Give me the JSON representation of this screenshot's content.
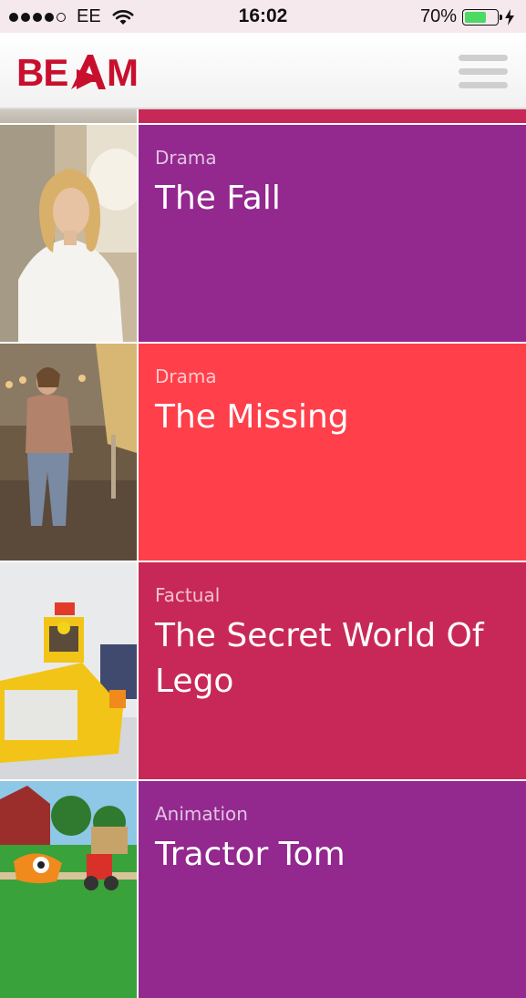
{
  "status_bar": {
    "carrier": "EE",
    "time": "16:02",
    "battery_percent_label": "70%",
    "battery_level": 0.7,
    "signal_dots_filled": 4,
    "signal_dots_total": 5
  },
  "header": {
    "logo_text": "BEAM",
    "menu_icon": "hamburger-menu-icon"
  },
  "colors": {
    "purple": "#93288f",
    "red": "#ff3f4a",
    "crimson": "#c82858"
  },
  "programmes": [
    {
      "genre": "Drama",
      "title": "The Fall",
      "color": "#93288f"
    },
    {
      "genre": "Drama",
      "title": "The Missing",
      "color": "#ff3f4a"
    },
    {
      "genre": "Factual",
      "title": "The Secret World Of Lego",
      "color": "#c82858"
    },
    {
      "genre": "Animation",
      "title": "Tractor Tom",
      "color": "#93288f"
    }
  ]
}
